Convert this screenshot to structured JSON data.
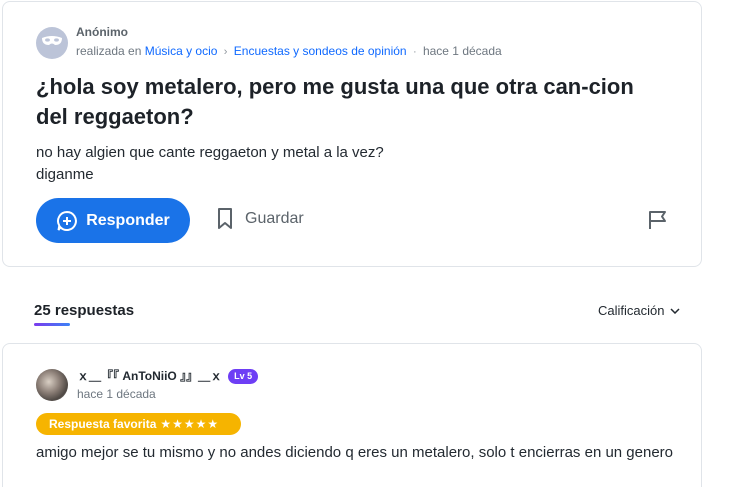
{
  "question": {
    "author": "Anónimo",
    "posted_in_prefix": "realizada en",
    "category": "Música y ocio",
    "subcategory": "Encuestas y sondeos de opinión",
    "time": "hace 1 década",
    "title": "¿hola soy metalero, pero me gusta una que otra can-cion del reggaeton?",
    "body_lines": [
      "no hay algien que cante reggaeton y metal a la vez?",
      "diganme"
    ],
    "actions": {
      "reply_label": "Responder",
      "save_label": "Guardar"
    },
    "icons": {
      "avatar": "mask-icon",
      "reply": "plus-bubble-icon",
      "save": "bookmark-icon",
      "report": "flag-icon",
      "separator": "chevron-right-icon"
    }
  },
  "answers_header": {
    "count_label": "25 respuestas",
    "sort_label": "Calificación",
    "sort_icon": "chevron-down-icon"
  },
  "answer": {
    "author": "ｘ＿『『 AnToNiiO 』』＿ｘ",
    "level": "Lv 5",
    "time": "hace 1 década",
    "badge_label": "Respuesta favorita",
    "stars": "★★★★★",
    "body": "amigo mejor se tu mismo y no andes diciendo q eres un metalero, solo t encierras en un genero"
  },
  "colors": {
    "primary": "#1a73e8",
    "link": "#0f69ff",
    "favorite": "#f6b400",
    "level_badge": "#6e3ef5"
  }
}
